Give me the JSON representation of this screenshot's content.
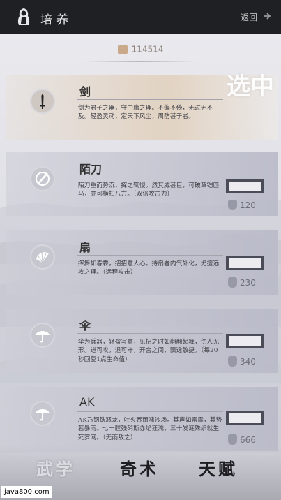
{
  "header": {
    "title": "培养",
    "back_label": "返回"
  },
  "currency": {
    "amount": "114514"
  },
  "stamp": "选中",
  "cards": [
    {
      "name": "剑",
      "desc": "剑为君子之器，守中庸之理。不偏不倚，无过无不及。轻盈灵动，定天下风尘，周防甚于者。",
      "selected": true,
      "cost": ""
    },
    {
      "name": "陌刀",
      "desc": "陌刀重而势沉，挥之辄慢。然其威甚巨，可破革铠匹马，亦可横扫八方。（双倍攻击力）",
      "cost": "120"
    },
    {
      "name": "扇",
      "desc": "挥舞如春霖，招招意人心。持扇者内气外化，尤擅远攻之理。（远程攻击）",
      "cost": "230"
    },
    {
      "name": "伞",
      "desc": "伞为兵器，轻盈写意，见招之时如翻翻起舞，伤人无形。进可攻，退可守，开合之间，飘逸敏捷。（每20秒回复1点生命值）",
      "cost": "340"
    },
    {
      "name": "AK",
      "desc": "AK乃钢铁怒龙，吐火吞雨啸沙场。其声如雷霆，其势若暴雨。七十膛残硝斯赤焰狂流，三十发涟殊织就生死罗网。（无雨敌之）",
      "cost": "666"
    }
  ],
  "tabs": {
    "active": "武学",
    "t2": "奇术",
    "t3": "天赋"
  },
  "footer": "java800.com"
}
